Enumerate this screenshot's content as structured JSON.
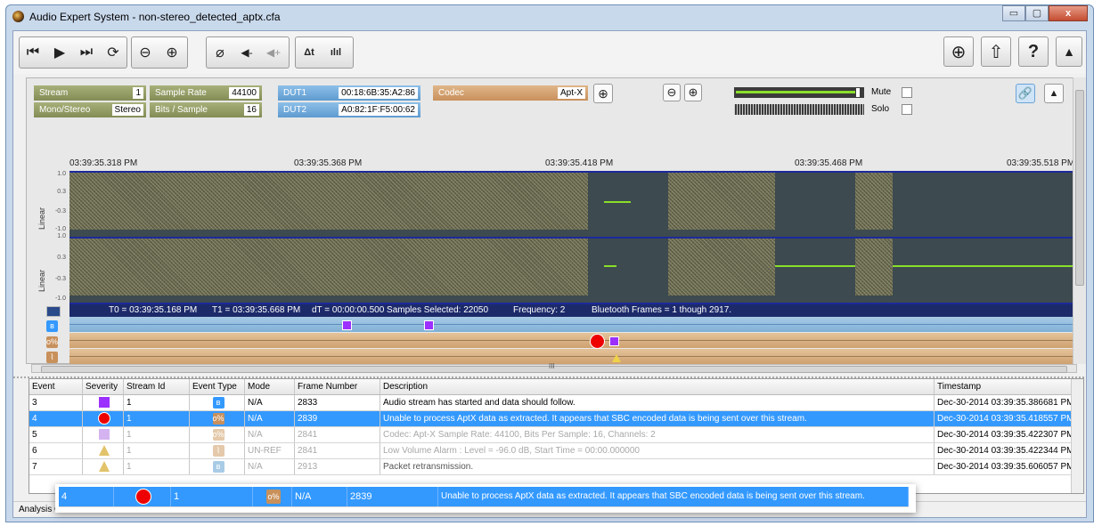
{
  "window": {
    "title": "Audio Expert System - non-stereo_detected_aptx.cfa",
    "min": "▭",
    "max": "▢",
    "close": "x"
  },
  "toolbar": {
    "buttons": [
      "skip-back",
      "play",
      "skip-forward",
      "loop",
      "zoom-out-time",
      "zoom-in-time",
      "mute-speaker",
      "volume-down",
      "volume-up",
      "eq-delta",
      "eq-bars"
    ],
    "glyphs": {
      "skip_back": "⏮",
      "play": "▶",
      "skip_forward": "⏭",
      "loop": "⟳",
      "zoom_out": "⊖",
      "zoom_in": "⊕",
      "mute": "⌀",
      "vol_down": "◀-",
      "vol_up": "◀+",
      "eq_delta": "Δt",
      "eq_bars": "ılıl",
      "target": "⊕",
      "export": "⇧",
      "help": "?",
      "up": "▲"
    }
  },
  "panel": {
    "stream_label": "Stream",
    "stream_value": "1",
    "mono_label": "Mono/Stereo",
    "mono_value": "Stereo",
    "sample_rate_label": "Sample Rate",
    "sample_rate_value": "44100",
    "bits_label": "Bits / Sample",
    "bits_value": "16",
    "dut1_label": "DUT1",
    "dut1_value": "00:18:6B:35:A2:86",
    "dut2_label": "DUT2",
    "dut2_value": "A0:82:1F:F5:00:62",
    "codec_label": "Codec",
    "codec_value": "Apt-X",
    "mute_label": "Mute",
    "solo_label": "Solo"
  },
  "wave": {
    "times": [
      "03:39:35.318 PM",
      "03:39:35.368 PM",
      "03:39:35.418 PM",
      "03:39:35.468 PM",
      "03:39:35.518 PM"
    ],
    "ylabel_top": "Linear",
    "ylabel_bottom": "Linear",
    "yticks": [
      "1.0",
      "0.3",
      "-0.3",
      "-1.0"
    ],
    "info_t0": "T0 = 03:39:35.168 PM",
    "info_t1": "T1 = 03:39:35.668 PM",
    "info_dt": "dT = 00:00:00.500 Samples Selected: 22050",
    "info_freq": "Frequency: 2",
    "info_bt": "Bluetooth Frames = 1 though 2917."
  },
  "scroll": {
    "grip": "III"
  },
  "grid": {
    "headers": [
      "Event",
      "Severity",
      "Stream Id",
      "Event Type",
      "Mode",
      "Frame Number",
      "Description",
      "Timestamp"
    ],
    "rows": [
      {
        "event": "3",
        "stream": "1",
        "mode": "N/A",
        "frame": "2833",
        "desc": "Audio stream has started and data should follow.",
        "ts": "Dec-30-2014 03:39:35.386681 PM"
      },
      {
        "event": "4",
        "stream": "1",
        "mode": "N/A",
        "frame": "2839",
        "desc": "Unable to process AptX data as extracted. It appears that SBC encoded data is being sent over this stream.",
        "ts": "Dec-30-2014 03:39:35.418557 PM"
      },
      {
        "event": "5",
        "stream": "1",
        "mode": "N/A",
        "frame": "2841",
        "desc": "Codec: Apt-X Sample Rate: 44100, Bits Per Sample: 16, Channels: 2",
        "ts": "Dec-30-2014 03:39:35.422307 PM"
      },
      {
        "event": "6",
        "stream": "1",
        "mode": "UN-REF",
        "frame": "2841",
        "desc": "Low Volume Alarm : Level = -96.0 dB, Start Time = 00:00.000000",
        "ts": "Dec-30-2014 03:39:35.422344 PM"
      },
      {
        "event": "7",
        "stream": "1",
        "mode": "N/A",
        "frame": "2913",
        "desc": "Packet retransmission.",
        "ts": "Dec-30-2014 03:39:35.606057 PM"
      }
    ]
  },
  "status": {
    "label": "Analysis C"
  },
  "colors": {
    "selection": "#3399ff",
    "wave_bg": "#3d4a4f",
    "signal": "#8adf2a",
    "accent_purple": "#9b30ff",
    "accent_red": "#e00000"
  }
}
